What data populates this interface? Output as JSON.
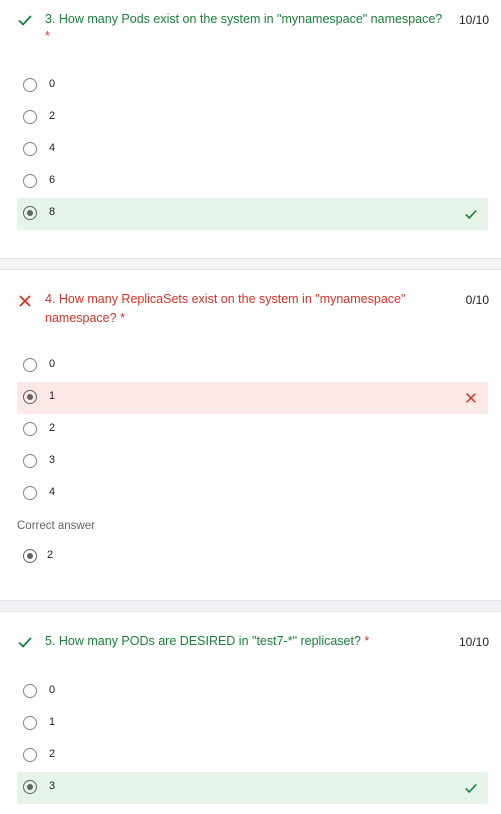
{
  "q3": {
    "text": "3. How many Pods exist on the system in \"mynamespace\" namespace?",
    "required": "*",
    "points": "10/10",
    "options": [
      "0",
      "2",
      "4",
      "6",
      "8"
    ],
    "selected_index": 4,
    "status": "correct"
  },
  "q4": {
    "text_line1": "4. How many ReplicaSets exist on the system in \"mynamespace\"",
    "text_line2": "namespace?",
    "required": "*",
    "points": "0/10",
    "options": [
      "0",
      "1",
      "2",
      "3",
      "4"
    ],
    "selected_index": 1,
    "status": "incorrect",
    "correct_answer_label": "Correct answer",
    "correct_answer": "2"
  },
  "q5": {
    "text": "5. How many PODs are DESIRED in \"test7-*\" replicaset?",
    "required": "*",
    "points": "10/10",
    "options": [
      "0",
      "1",
      "2",
      "3"
    ],
    "selected_index": 3,
    "status": "correct"
  },
  "colors": {
    "correct": "#188038",
    "incorrect": "#d93025",
    "correct_bg": "#e6f4ea",
    "incorrect_bg": "#fce8e6"
  },
  "icons": {
    "correct": "check-icon",
    "incorrect": "cross-icon"
  }
}
